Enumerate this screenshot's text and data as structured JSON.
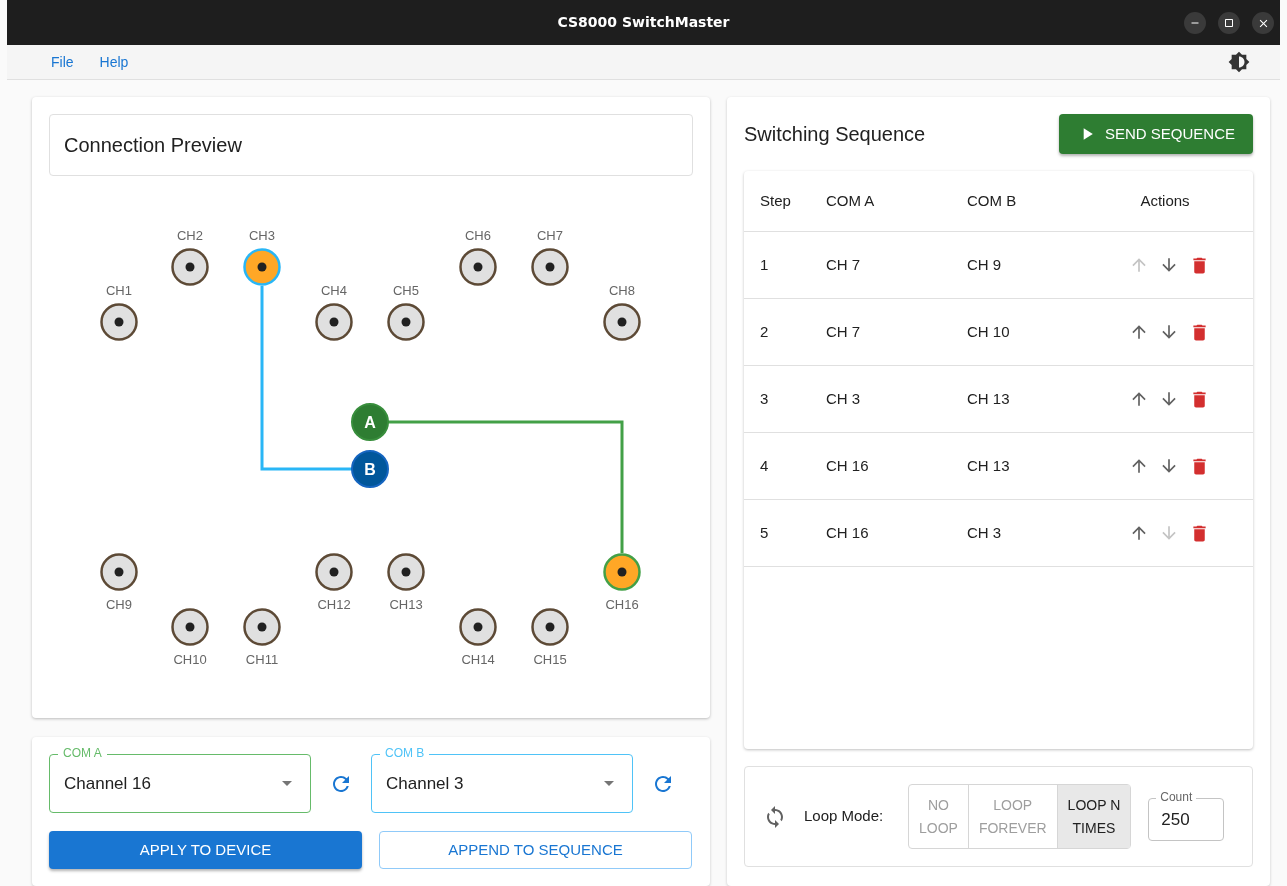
{
  "window": {
    "title": "CS8000 SwitchMaster"
  },
  "menu": [
    {
      "label": "File"
    },
    {
      "label": "Help"
    }
  ],
  "preview": {
    "title": "Connection Preview",
    "channels": [
      {
        "label": "CH1",
        "connected_a": false,
        "connected_b": false
      },
      {
        "label": "CH2",
        "connected_a": false,
        "connected_b": false
      },
      {
        "label": "CH3",
        "connected_a": false,
        "connected_b": true
      },
      {
        "label": "CH4",
        "connected_a": false,
        "connected_b": false
      },
      {
        "label": "CH5",
        "connected_a": false,
        "connected_b": false
      },
      {
        "label": "CH6",
        "connected_a": false,
        "connected_b": false
      },
      {
        "label": "CH7",
        "connected_a": false,
        "connected_b": false
      },
      {
        "label": "CH8",
        "connected_a": false,
        "connected_b": false
      },
      {
        "label": "CH9",
        "connected_a": false,
        "connected_b": false
      },
      {
        "label": "CH10",
        "connected_a": false,
        "connected_b": false
      },
      {
        "label": "CH11",
        "connected_a": false,
        "connected_b": false
      },
      {
        "label": "CH12",
        "connected_a": false,
        "connected_b": false
      },
      {
        "label": "CH13",
        "connected_a": false,
        "connected_b": false
      },
      {
        "label": "CH14",
        "connected_a": false,
        "connected_b": false
      },
      {
        "label": "CH15",
        "connected_a": false,
        "connected_b": false
      },
      {
        "label": "CH16",
        "connected_a": true,
        "connected_b": false
      }
    ],
    "com_nodes": [
      {
        "label": "A",
        "kind": "a",
        "color": "#2e7d32"
      },
      {
        "label": "B",
        "kind": "b",
        "color": "#01579b"
      }
    ]
  },
  "selects": [
    {
      "label": "COM A",
      "value": "Channel 16"
    },
    {
      "label": "COM B",
      "value": "Channel 3"
    }
  ],
  "buttons": [
    {
      "label": "APPLY TO DEVICE"
    },
    {
      "label": "APPEND TO SEQUENCE"
    }
  ],
  "sequence": {
    "title": "Switching Sequence",
    "send_button": "SEND SEQUENCE",
    "columns": [
      "Step",
      "COM A",
      "COM B",
      "Actions"
    ],
    "rows": [
      {
        "step": "1",
        "com_a": "CH 7",
        "com_b": "CH 9",
        "up_disabled": true,
        "down_disabled": false
      },
      {
        "step": "2",
        "com_a": "CH 7",
        "com_b": "CH 10",
        "up_disabled": false,
        "down_disabled": false
      },
      {
        "step": "3",
        "com_a": "CH 3",
        "com_b": "CH 13",
        "up_disabled": false,
        "down_disabled": false
      },
      {
        "step": "4",
        "com_a": "CH 16",
        "com_b": "CH 13",
        "up_disabled": false,
        "down_disabled": false
      },
      {
        "step": "5",
        "com_a": "CH 16",
        "com_b": "CH 3",
        "up_disabled": false,
        "down_disabled": true
      }
    ]
  },
  "loop": {
    "label": "Loop Mode:",
    "options": [
      {
        "lines": [
          "NO",
          "LOOP"
        ],
        "selected": false
      },
      {
        "lines": [
          "LOOP",
          "FOREVER"
        ],
        "selected": false
      },
      {
        "lines": [
          "LOOP N",
          "TIMES"
        ],
        "selected": true
      }
    ],
    "count": {
      "label": "Count",
      "value": "250"
    }
  }
}
